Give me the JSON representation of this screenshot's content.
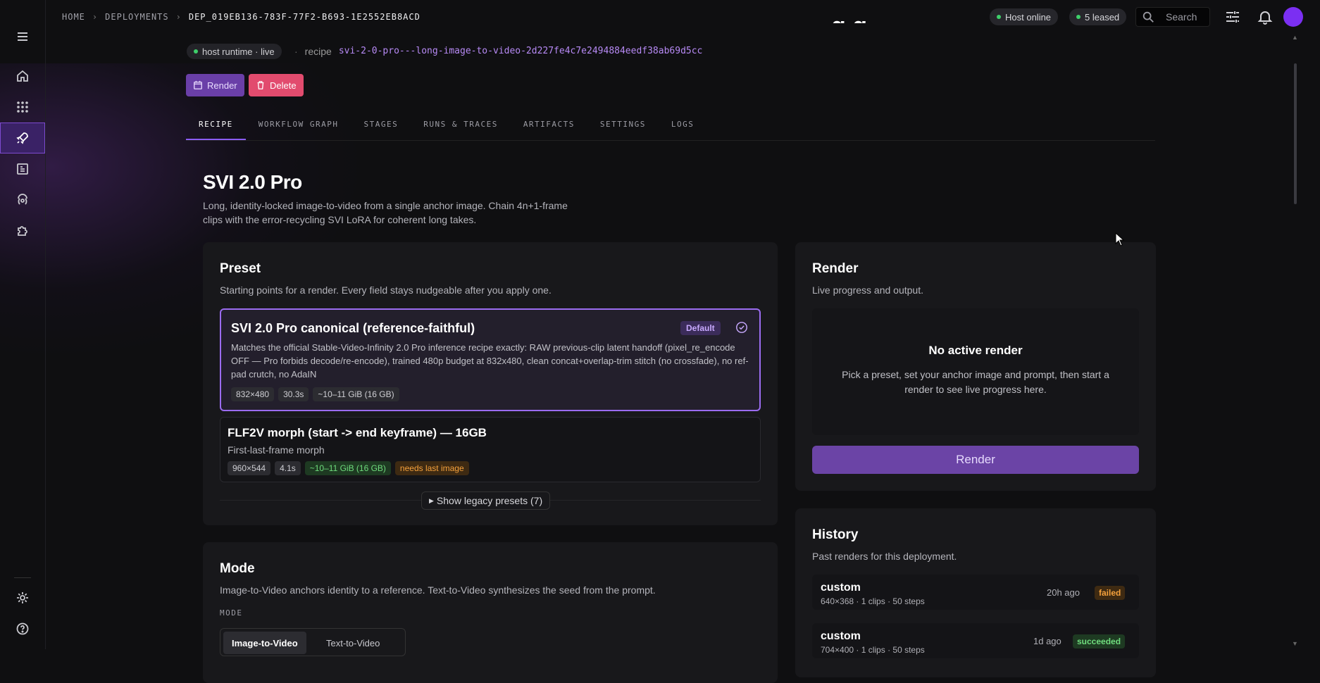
{
  "breadcrumbs": [
    "HOME",
    "DEPLOYMENTS",
    "DEP_019EB136-783F-77F2-B693-1E2552EB8ACD"
  ],
  "topbar": {
    "host_status": "Host online",
    "leased": "5 leased",
    "search_placeholder": "Search"
  },
  "header": {
    "runtime_pill": "host runtime · live",
    "recipe_label": "recipe",
    "recipe_value": "svi-2-0-pro---long-image-to-video-2d227fe4c7e2494884eedf38ab69d5cc",
    "render_button": "Render",
    "delete_button": "Delete",
    "partial_title": "g g"
  },
  "tabs": [
    "RECIPE",
    "WORKFLOW GRAPH",
    "STAGES",
    "RUNS & TRACES",
    "ARTIFACTS",
    "SETTINGS",
    "LOGS"
  ],
  "recipe": {
    "title": "SVI 2.0 Pro",
    "description": "Long, identity-locked image-to-video from a single anchor image. Chain 4n+1-frame clips with the error-recycling SVI LoRA for coherent long takes."
  },
  "preset": {
    "title": "Preset",
    "subtitle": "Starting points for a render. Every field stays nudgeable after you apply one.",
    "items": [
      {
        "title": "SVI 2.0 Pro canonical (reference-faithful)",
        "badge": "Default",
        "description": "Matches the official Stable-Video-Infinity 2.0 Pro inference recipe exactly: RAW previous-clip latent handoff (pixel_re_encode OFF — Pro forbids decode/re-encode), trained 480p budget at 832x480, clean concat+overlap-trim stitch (no crossfade), no ref-pad crutch, no AdaIN",
        "chips": [
          "832×480",
          "30.3s",
          "~10–11 GiB (16 GB)"
        ]
      },
      {
        "title": "FLF2V morph (start -> end keyframe) — 16GB",
        "description": "First-last-frame morph",
        "chips": [
          "960×544",
          "4.1s",
          "~10–11 GiB (16 GB)",
          "needs last image"
        ]
      }
    ],
    "legacy_button": "Show legacy presets (7)"
  },
  "render_card": {
    "title": "Render",
    "subtitle": "Live progress and output.",
    "empty_title": "No active render",
    "empty_desc": "Pick a preset, set your anchor image and prompt, then start a render to see live progress here.",
    "button": "Render"
  },
  "history": {
    "title": "History",
    "subtitle": "Past renders for this deployment.",
    "rows": [
      {
        "name": "custom",
        "meta": "640×368 · 1 clips · 50 steps",
        "time": "20h ago",
        "status": "failed"
      },
      {
        "name": "custom",
        "meta": "704×400 · 1 clips · 50 steps",
        "time": "1d ago",
        "status": "succeeded"
      }
    ]
  },
  "mode": {
    "title": "Mode",
    "subtitle": "Image-to-Video anchors identity to a reference. Text-to-Video synthesizes the seed from the prompt.",
    "label": "MODE",
    "options": [
      "Image-to-Video",
      "Text-to-Video"
    ],
    "selected": "Image-to-Video"
  },
  "colors": {
    "accent": "#8b5cf6",
    "online": "#3ecf6a",
    "failed": "#f5a13c",
    "succeeded": "#6fdc7d",
    "delete": "#e24b6e"
  },
  "icons": [
    "menu-icon",
    "home-icon",
    "grid-icon",
    "rocket-icon",
    "dashboard-icon",
    "deploy-icon",
    "puzzle-icon",
    "settings-icon",
    "help-icon",
    "search-icon",
    "sliders-icon",
    "bell-icon",
    "check-circle-icon",
    "calendar-icon",
    "trash-icon"
  ]
}
